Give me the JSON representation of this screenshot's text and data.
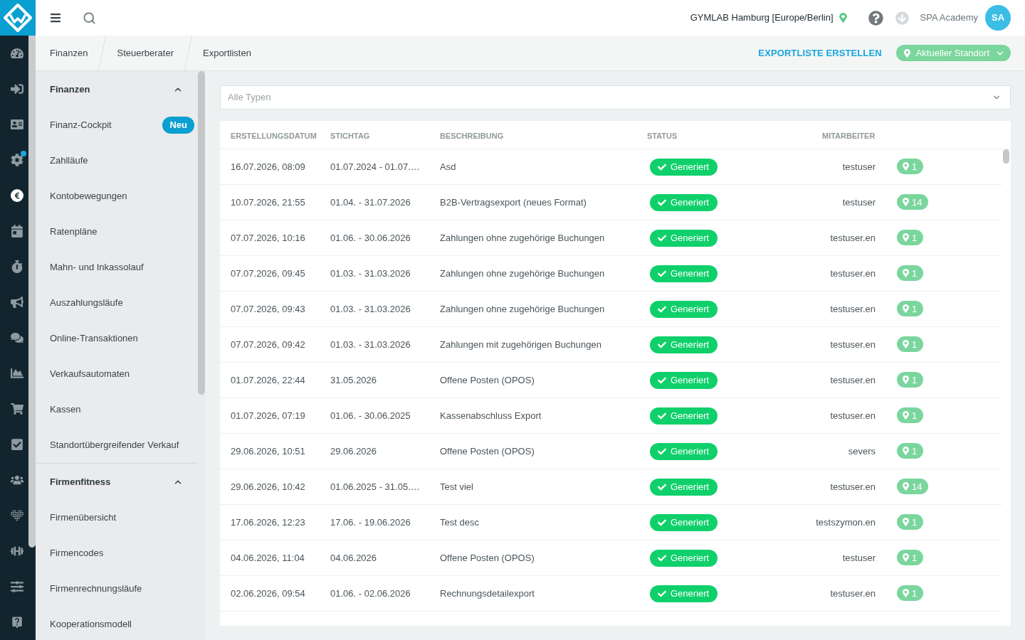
{
  "rail": [
    {
      "selected": false,
      "notification": false
    },
    {
      "selected": false,
      "notification": false
    },
    {
      "selected": false,
      "notification": false
    },
    {
      "selected": false,
      "notification": true
    },
    {
      "selected": true,
      "notification": false
    },
    {
      "selected": false,
      "notification": false
    },
    {
      "selected": false,
      "notification": false
    },
    {
      "selected": false,
      "notification": false
    },
    {
      "selected": false,
      "notification": false
    },
    {
      "selected": false,
      "notification": false
    },
    {
      "selected": false,
      "notification": false
    },
    {
      "selected": false,
      "notification": false
    },
    {
      "selected": false,
      "notification": false
    },
    {
      "selected": false,
      "notification": false
    },
    {
      "selected": false,
      "notification": false
    },
    {
      "selected": false,
      "notification": false
    },
    {
      "selected": false,
      "notification": false
    }
  ],
  "topbar": {
    "location": "GYMLAB Hamburg [Europe/Berlin]",
    "user": "SPA Academy",
    "avatar_initials": "SA"
  },
  "breadcrumbs": [
    "Finanzen",
    "Steuerberater",
    "Exportlisten"
  ],
  "actions": {
    "create_export": "EXPORTLISTE ERSTELLEN",
    "location_filter": "Aktueller Standort"
  },
  "sidebar": {
    "sections": [
      {
        "title": "Finanzen",
        "expanded": true,
        "items": [
          {
            "label": "Finanz-Cockpit",
            "badge": "Neu"
          },
          {
            "label": "Zahlläufe"
          },
          {
            "label": "Kontobewegungen"
          },
          {
            "label": "Ratenpläne"
          },
          {
            "label": "Mahn- und Inkassolauf"
          },
          {
            "label": "Auszahlungsläufe"
          },
          {
            "label": "Online-Transaktionen"
          },
          {
            "label": "Verkaufsautomaten"
          },
          {
            "label": "Kassen"
          },
          {
            "label": "Standortübergreifender Verkauf"
          }
        ]
      },
      {
        "title": "Firmenfitness",
        "expanded": true,
        "items": [
          {
            "label": "Firmenübersicht"
          },
          {
            "label": "Firmencodes"
          },
          {
            "label": "Firmenrechnungsläufe"
          },
          {
            "label": "Kooperationsmodell"
          }
        ]
      }
    ]
  },
  "type_filter": {
    "placeholder": "Alle Typen"
  },
  "table": {
    "columns": [
      "ERSTELLUNGSDATUM",
      "STICHTAG",
      "BESCHREIBUNG",
      "STATUS",
      "MITARBEITER"
    ],
    "rows": [
      {
        "created": "16.07.2026, 08:09",
        "reference_date": "01.07.2024 - 01.07.…",
        "description": "Asd",
        "status": "Generiert",
        "employee": "testuser",
        "locations": "1"
      },
      {
        "created": "10.07.2026, 21:55",
        "reference_date": "01.04. - 31.07.2026",
        "description": "B2B-Vertragsexport (neues Format)",
        "status": "Generiert",
        "employee": "testuser",
        "locations": "14"
      },
      {
        "created": "07.07.2026, 10:16",
        "reference_date": "01.06. - 30.06.2026",
        "description": "Zahlungen ohne zugehörige Buchungen",
        "status": "Generiert",
        "employee": "testuser.en",
        "locations": "1"
      },
      {
        "created": "07.07.2026, 09:45",
        "reference_date": "01.03. - 31.03.2026",
        "description": "Zahlungen ohne zugehörige Buchungen",
        "status": "Generiert",
        "employee": "testuser.en",
        "locations": "1"
      },
      {
        "created": "07.07.2026, 09:43",
        "reference_date": "01.03. - 31.03.2026",
        "description": "Zahlungen ohne zugehörige Buchungen",
        "status": "Generiert",
        "employee": "testuser.en",
        "locations": "1"
      },
      {
        "created": "07.07.2026, 09:42",
        "reference_date": "01.03. - 31.03.2026",
        "description": "Zahlungen mit zugehörigen Buchungen",
        "status": "Generiert",
        "employee": "testuser.en",
        "locations": "1"
      },
      {
        "created": "01.07.2026, 22:44",
        "reference_date": "31.05.2026",
        "description": "Offene Posten (OPOS)",
        "status": "Generiert",
        "employee": "testuser.en",
        "locations": "1"
      },
      {
        "created": "01.07.2026, 07:19",
        "reference_date": "01.06. - 30.06.2025",
        "description": "Kassenabschluss Export",
        "status": "Generiert",
        "employee": "testuser.en",
        "locations": "1"
      },
      {
        "created": "29.06.2026, 10:51",
        "reference_date": "29.06.2026",
        "description": "Offene Posten (OPOS)",
        "status": "Generiert",
        "employee": "severs",
        "locations": "1"
      },
      {
        "created": "29.06.2026, 10:42",
        "reference_date": "01.06.2025 - 31.05.…",
        "description": "Test viel",
        "status": "Generiert",
        "employee": "testuser.en",
        "locations": "14"
      },
      {
        "created": "17.06.2026, 12:23",
        "reference_date": "17.06. - 19.06.2026",
        "description": "Test desc",
        "status": "Generiert",
        "employee": "testszymon.en",
        "locations": "1"
      },
      {
        "created": "04.06.2026, 11:04",
        "reference_date": "04.06.2026",
        "description": "Offene Posten (OPOS)",
        "status": "Generiert",
        "employee": "testuser",
        "locations": "1"
      },
      {
        "created": "02.06.2026, 09:54",
        "reference_date": "01.06. - 02.06.2026",
        "description": "Rechnungsdetailexport",
        "status": "Generiert",
        "employee": "testuser.en",
        "locations": "1"
      }
    ]
  }
}
